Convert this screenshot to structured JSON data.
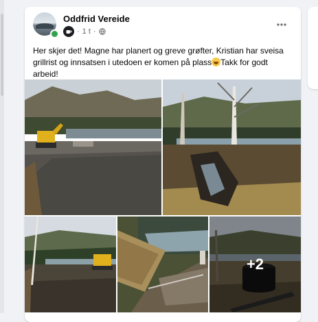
{
  "post": {
    "author": "Oddfrid Vereide",
    "timestamp": "1 t",
    "separator": "·",
    "text_before_emoji": "Her skjer det! Magne har planert og greve grøfter, Kristian har sveisa grillrist og innsatsen i utedoen er komen på plass",
    "text_after_emoji": "Takk for godt arbeid!",
    "emoji": "grinning-face-emoji",
    "more_photos_label": "+2"
  },
  "icons": {
    "more": "more-options-icon",
    "privacy": "globe-icon",
    "group": "coffee-cup-icon",
    "online": "online-status-icon"
  },
  "colors": {
    "online": "#31a24c",
    "text": "#050505",
    "secondary_text": "#65676b"
  }
}
